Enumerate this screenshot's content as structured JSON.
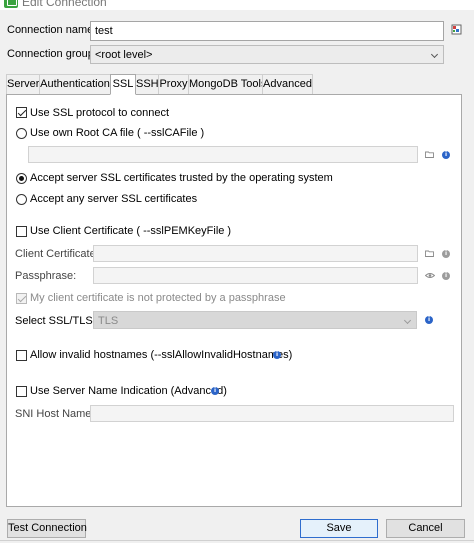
{
  "window": {
    "title": "Edit Connection"
  },
  "form": {
    "connection_name_label": "Connection name:",
    "connection_name_value": "test",
    "connection_group_label": "Connection group:",
    "connection_group_value": "<root level>"
  },
  "tabs": [
    {
      "label": "Server",
      "active": false
    },
    {
      "label": "Authentication",
      "active": false
    },
    {
      "label": "SSL",
      "active": true
    },
    {
      "label": "SSH",
      "active": false
    },
    {
      "label": "Proxy",
      "active": false
    },
    {
      "label": "MongoDB Tools",
      "active": false
    },
    {
      "label": "Advanced",
      "active": false
    }
  ],
  "ssl": {
    "use_ssl_label": "Use SSL protocol to connect",
    "use_ssl_checked": true,
    "own_ca_label": "Use own Root CA file ( --sslCAFile )",
    "trusted_label": "Accept server SSL certificates trusted by the operating system",
    "any_label": "Accept any server SSL certificates",
    "client_cert_checkbox_label": "Use Client Certificate ( --sslPEMKeyFile )",
    "client_cert_label": "Client Certificate:",
    "passphrase_label": "Passphrase:",
    "not_protected_label": "My client certificate is not protected by a passphrase",
    "select_ssl_label": "Select SSL/TLS:",
    "select_ssl_value": "TLS",
    "invalid_hostnames_label": "Allow invalid hostnames (--sslAllowInvalidHostnames)",
    "sni_label": "Use Server Name Indication (Advanced)",
    "sni_host_label": "SNI Host Name:"
  },
  "buttons": {
    "test_connection": "Test Connection",
    "save": "Save",
    "cancel": "Cancel"
  },
  "icons": {
    "info": "info-icon",
    "folder": "folder-icon",
    "eye": "eye-icon",
    "database": "database-icon",
    "app": "app-icon"
  },
  "colors": {
    "accent_blue": "#2b64c8",
    "default_button_border": "#2f6dce",
    "app_green": "#3aa340"
  }
}
